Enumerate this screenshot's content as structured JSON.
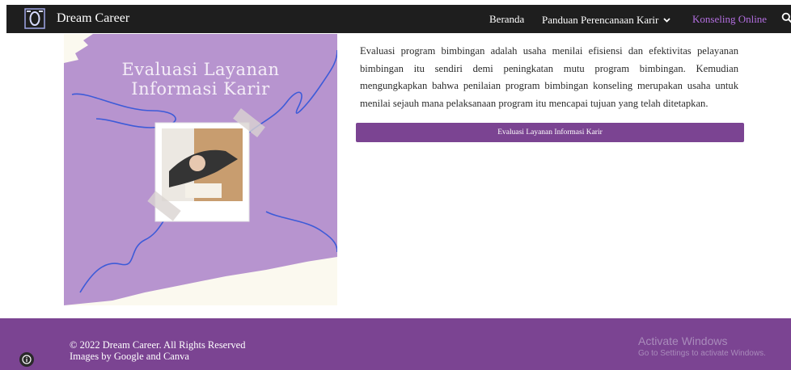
{
  "header": {
    "brand": "Dream Career",
    "nav": {
      "beranda": "Beranda",
      "panduan": "Panduan Perencanaan Karir",
      "konseling": "Konseling Online"
    },
    "accent_color": "#b36ee0",
    "icons": [
      "dream-career-logo",
      "chevron-down-icon",
      "search-icon"
    ]
  },
  "hero": {
    "title_line1": "Evaluasi Layanan",
    "title_line2": "Informasi Karir",
    "background_color": "#b794cf"
  },
  "main": {
    "description": "Evaluasi program bimbingan adalah usaha menilai efisiensi dan efektivitas pelayanan bimbingan itu sendiri demi peningkatan mutu program bimbingan. Kemudian mengungkapkan bahwa penilaian program bimbingan konseling merupakan usaha untuk menilai sejauh mana pelaksanaan program itu mencapai tujuan yang telah ditetapkan.",
    "button_label": "Evaluasi Layanan Informasi Karir",
    "button_color": "#7b4492"
  },
  "footer": {
    "copyright": "© 2022 Dream Career. All Rights Reserved",
    "credit": "Images by Google and Canva",
    "background_color": "#7b4492"
  },
  "watermark": {
    "title": "Activate Windows",
    "subtitle": "Go to Settings to activate Windows."
  }
}
